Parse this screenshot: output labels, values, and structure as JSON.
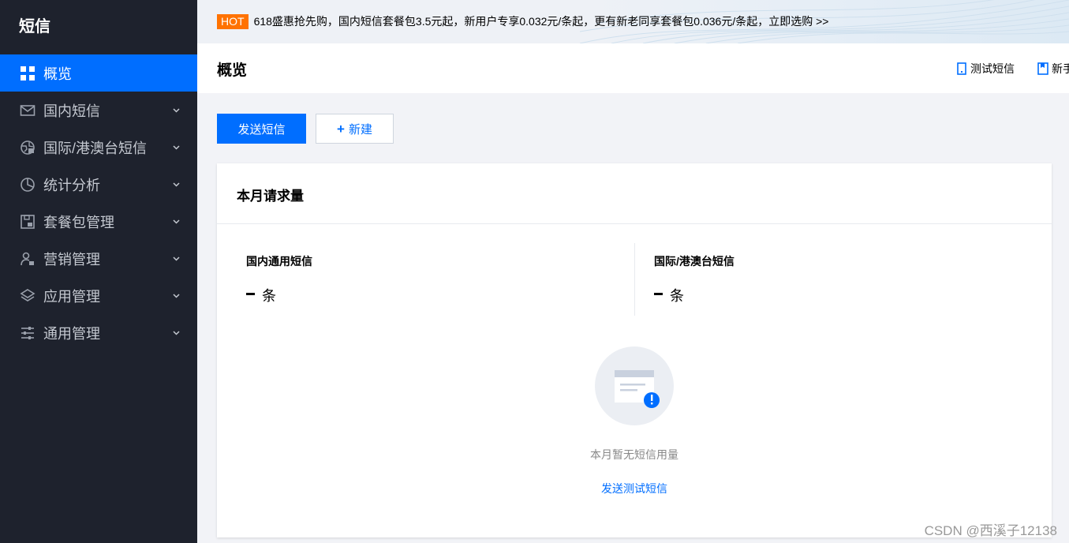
{
  "sidebar": {
    "title": "短信",
    "items": [
      {
        "label": "概览",
        "icon": "grid-icon",
        "active": true
      },
      {
        "label": "国内短信",
        "icon": "mail-icon"
      },
      {
        "label": "国际/港澳台短信",
        "icon": "globe-icon"
      },
      {
        "label": "统计分析",
        "icon": "pie-chart-icon"
      },
      {
        "label": "套餐包管理",
        "icon": "package-icon"
      },
      {
        "label": "营销管理",
        "icon": "user-group-icon"
      },
      {
        "label": "应用管理",
        "icon": "layers-icon"
      },
      {
        "label": "通用管理",
        "icon": "sliders-icon"
      }
    ]
  },
  "banner": {
    "tag": "HOT",
    "text": "618盛惠抢先购，国内短信套餐包3.5元起，新用户专享0.032元/条起，更有新老同享套餐包0.036元/条起，立即选购 >>"
  },
  "header": {
    "title": "概览",
    "links": [
      {
        "label": "测试短信",
        "icon": "phone-icon"
      },
      {
        "label": "新手",
        "icon": "book-icon"
      }
    ]
  },
  "actions": {
    "send_label": "发送短信",
    "new_plus": "+",
    "new_label": "新建"
  },
  "card": {
    "title": "本月请求量",
    "stats": [
      {
        "label": "国内通用短信",
        "unit": "条"
      },
      {
        "label": "国际/港澳台短信",
        "unit": "条"
      }
    ],
    "empty_text": "本月暂无短信用量",
    "empty_link": "发送测试短信"
  },
  "watermark": "CSDN @西溪子12138",
  "colors": {
    "primary": "#006eff",
    "sidebar_bg": "#1e222d",
    "hot": "#ff7200"
  }
}
